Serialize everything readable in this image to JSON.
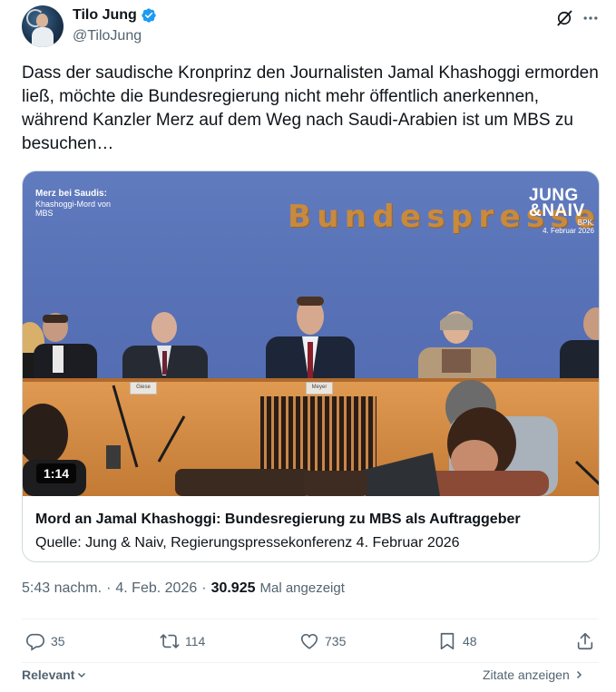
{
  "author": {
    "name": "Tilo Jung",
    "handle": "@TiloJung"
  },
  "tweet": {
    "text": "Dass der saudische Kronprinz den Journalisten Jamal Khashoggi ermorden ließ, möchte die Bundesregierung nicht mehr öffentlich anerkennen, während Kanzler Merz auf dem Weg nach Saudi-Arabien ist um MBS zu besuchen…"
  },
  "video": {
    "overlay_title": "Merz bei Saudis:",
    "overlay_subtitle": "Khashoggi-Mord von MBS",
    "brand_line1": "JUNG",
    "brand_line2": "&NAIV",
    "bpk_line1": "BPK,",
    "bpk_line2": "4. Februar 2026",
    "wall_text": "Bundespresseko",
    "duration": "1:14",
    "nameplate_1": "Giese",
    "nameplate_2": "Meyer"
  },
  "card": {
    "title": "Mord an Jamal Khashoggi: Bundesregierung zu MBS als Auftraggeber",
    "source": "Quelle: Jung & Naiv, Regierungspressekonferenz 4. Februar 2026"
  },
  "meta": {
    "time": "5:43 nachm.",
    "sep1": "·",
    "date": "4. Feb. 2026",
    "sep2": "·",
    "views_count": "30.925",
    "views_label": "Mal angezeigt"
  },
  "actions": {
    "replies": "35",
    "reposts": "114",
    "likes": "735",
    "bookmarks": "48"
  },
  "footer": {
    "sort_label": "Relevant",
    "quotes_label": "Zitate anzeigen"
  },
  "colors": {
    "verified": "#1d9bf0",
    "muted": "#536471",
    "wall_blue": "#5872b8",
    "desk_wood": "#d58f48"
  }
}
